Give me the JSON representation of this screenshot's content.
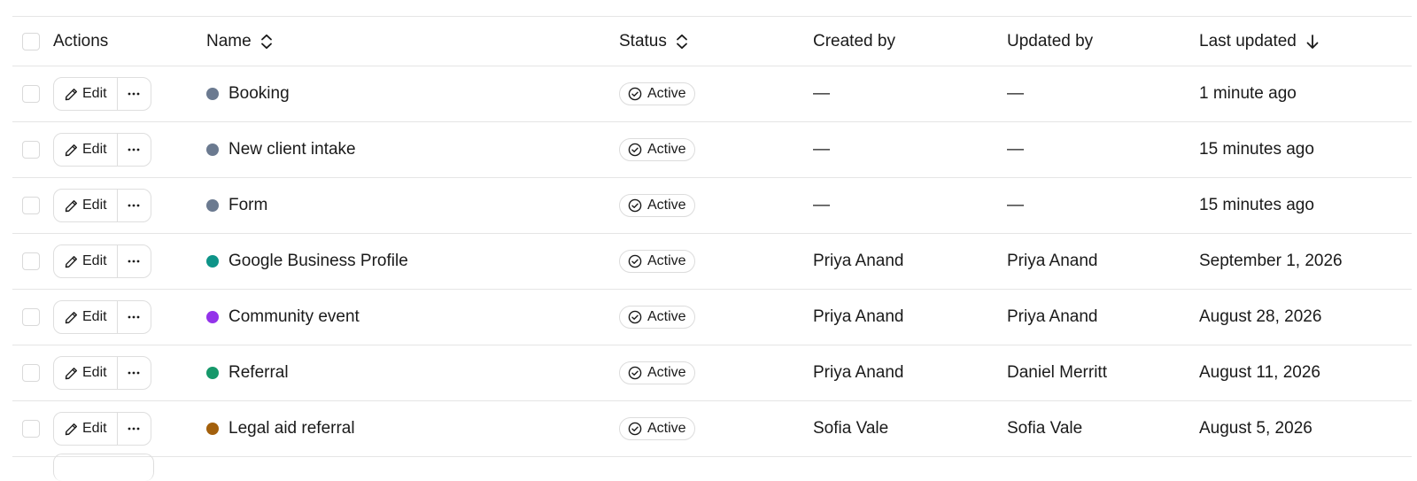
{
  "header": {
    "actions": "Actions",
    "name": "Name",
    "status": "Status",
    "created_by": "Created by",
    "updated_by": "Updated by",
    "last_updated": "Last updated"
  },
  "edit_label": "Edit",
  "rows": [
    {
      "name": "Booking",
      "dot_color": "#6b7a90",
      "status": "Active",
      "created_by": "—",
      "updated_by": "—",
      "last_updated": "1 minute ago"
    },
    {
      "name": "New client intake",
      "dot_color": "#6b7a90",
      "status": "Active",
      "created_by": "—",
      "updated_by": "—",
      "last_updated": "15 minutes ago"
    },
    {
      "name": "Form",
      "dot_color": "#6b7a90",
      "status": "Active",
      "created_by": "—",
      "updated_by": "—",
      "last_updated": "15 minutes ago"
    },
    {
      "name": "Google Business Profile",
      "dot_color": "#0e9488",
      "status": "Active",
      "created_by": "Priya Anand",
      "updated_by": "Priya Anand",
      "last_updated": "September 1, 2026"
    },
    {
      "name": "Community event",
      "dot_color": "#9333ea",
      "status": "Active",
      "created_by": "Priya Anand",
      "updated_by": "Priya Anand",
      "last_updated": "August 28, 2026"
    },
    {
      "name": "Referral",
      "dot_color": "#16986a",
      "status": "Active",
      "created_by": "Priya Anand",
      "updated_by": "Daniel Merritt",
      "last_updated": "August 11, 2026"
    },
    {
      "name": "Legal aid referral",
      "dot_color": "#a3600c",
      "status": "Active",
      "created_by": "Sofia Vale",
      "updated_by": "Sofia Vale",
      "last_updated": "August 5, 2026"
    }
  ]
}
